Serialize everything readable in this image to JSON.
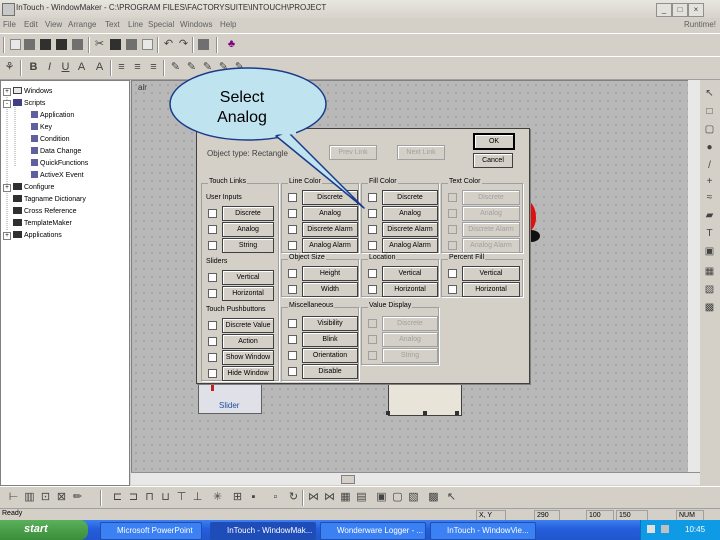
{
  "window": {
    "title": "InTouch - WindowMaker - C:\\PROGRAM FILES\\FACTORYSUITE\\INTOUCH\\PROJECT",
    "runtime_label": "Runtime!"
  },
  "menu": [
    "File",
    "Edit",
    "View",
    "Arrange",
    "Text",
    "Line",
    "Special",
    "Windows",
    "Help"
  ],
  "tree": [
    {
      "label": "Windows",
      "level": 0,
      "expander": "+"
    },
    {
      "label": "Scripts",
      "level": 0,
      "expander": "-"
    },
    {
      "label": "Application",
      "level": 1
    },
    {
      "label": "Key",
      "level": 1
    },
    {
      "label": "Condition",
      "level": 1
    },
    {
      "label": "Data Change",
      "level": 1
    },
    {
      "label": "QuickFunctions",
      "level": 1
    },
    {
      "label": "ActiveX Event",
      "level": 1
    },
    {
      "label": "Configure",
      "level": 0,
      "expander": "+"
    },
    {
      "label": "Tagname Dictionary",
      "level": 0
    },
    {
      "label": "Cross Reference",
      "level": 0
    },
    {
      "label": "TemplateMaker",
      "level": 0
    },
    {
      "label": "Applications",
      "level": 0,
      "expander": "+"
    }
  ],
  "canvas": {
    "window_label": "air"
  },
  "callout": {
    "line1": "Select",
    "line2": "Analog"
  },
  "dialog": {
    "object_type_label": "Object type: Rectangle",
    "prev_link": "Prev Link",
    "next_link": "Next Link",
    "ok": "OK",
    "cancel": "Cancel",
    "groups": {
      "touch_links": {
        "title": "Touch Links",
        "user_inputs": {
          "title": "User Inputs",
          "items": [
            "Discrete",
            "Analog",
            "String"
          ]
        },
        "sliders": {
          "title": "Sliders",
          "items": [
            "Vertical",
            "Horizontal"
          ]
        },
        "touch_pushbuttons": {
          "title": "Touch Pushbuttons",
          "items": [
            "Discrete Value",
            "Action",
            "Show Window",
            "Hide Window"
          ]
        }
      },
      "line_color": {
        "title": "Line Color",
        "items": [
          "Discrete",
          "Analog",
          "Discrete Alarm",
          "Analog Alarm"
        ]
      },
      "fill_color": {
        "title": "Fill Color",
        "items": [
          "Discrete",
          "Analog",
          "Discrete Alarm",
          "Analog Alarm"
        ]
      },
      "text_color": {
        "title": "Text Color",
        "items": [
          "Discrete",
          "Analog",
          "Discrete Alarm",
          "Analog Alarm"
        ]
      },
      "object_size": {
        "title": "Object Size",
        "items": [
          "Height",
          "Width"
        ]
      },
      "location": {
        "title": "Location",
        "items": [
          "Vertical",
          "Horizontal"
        ]
      },
      "percent_fill": {
        "title": "Percent Fill",
        "items": [
          "Vertical",
          "Horizontal"
        ]
      },
      "miscellaneous": {
        "title": "Miscellaneous",
        "items": [
          "Visibility",
          "Blink",
          "Orientation",
          "Disable"
        ]
      },
      "value_display": {
        "title": "Value Display",
        "items": [
          "Discrete",
          "Analog",
          "String"
        ]
      }
    }
  },
  "canvas_objects": {
    "slider_label": "Slider"
  },
  "status": {
    "ready": "Ready",
    "xy_label": "X, Y",
    "x": "290",
    "y": "100",
    "w": "150",
    "num": "NUM"
  },
  "taskbar": {
    "start": "start",
    "buttons": [
      "Microsoft PowerPoint",
      "InTouch - WindowMak...",
      "Wonderware Logger - ...",
      "InTouch - WindowVie..."
    ],
    "tray_time": "10:45"
  },
  "colors": {
    "taskbar_blue": "#245edb",
    "canvas_gray": "#b8b8b8",
    "callout_fill": "#bfe3ef"
  }
}
